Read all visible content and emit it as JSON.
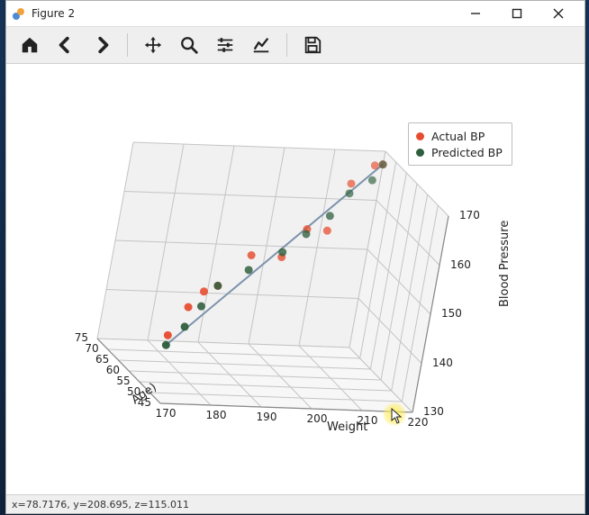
{
  "window": {
    "title": "Figure 2"
  },
  "toolbar": {
    "home": "Home",
    "back": "Back",
    "forward": "Forward",
    "pan": "Pan",
    "zoom": "Zoom",
    "configure": "Configure subplots",
    "edit": "Edit axis",
    "save": "Save"
  },
  "status": {
    "x_label": "x=",
    "x_val": "78.7176",
    "y_label": ", y=",
    "y_val": "208.695",
    "z_label": ", z=",
    "z_val": "115.011"
  },
  "legend": {
    "actual": "Actual BP",
    "predicted": "Predicted BP"
  },
  "axes": {
    "x_label": "Age)",
    "y_label": "Weight",
    "z_label": "Blood Pressure",
    "x_ticks": [
      "45",
      "50",
      "55",
      "60",
      "65",
      "70",
      "75"
    ],
    "y_ticks": [
      "170",
      "180",
      "190",
      "200",
      "210",
      "220"
    ],
    "z_ticks": [
      "130",
      "140",
      "150",
      "160",
      "170"
    ]
  },
  "chart_data": {
    "type": "scatter",
    "title": "",
    "xlabel": "Age)",
    "ylabel": "Weight",
    "zlabel": "Blood Pressure",
    "x_range": [
      45,
      75
    ],
    "y_range": [
      170,
      220
    ],
    "z_range": [
      130,
      170
    ],
    "series": [
      {
        "name": "Actual BP",
        "color": "#e64d30",
        "points": [
          {
            "age": 47,
            "weight": 170,
            "bp": 143
          },
          {
            "age": 49,
            "weight": 174,
            "bp": 148
          },
          {
            "age": 52,
            "weight": 178,
            "bp": 150
          },
          {
            "age": 55,
            "weight": 182,
            "bp": 150
          },
          {
            "age": 56,
            "weight": 188,
            "bp": 156
          },
          {
            "age": 58,
            "weight": 195,
            "bp": 155
          },
          {
            "age": 60,
            "weight": 200,
            "bp": 160
          },
          {
            "age": 62,
            "weight": 205,
            "bp": 159
          },
          {
            "age": 66,
            "weight": 210,
            "bp": 167
          },
          {
            "age": 68,
            "weight": 215,
            "bp": 170
          },
          {
            "age": 71,
            "weight": 218,
            "bp": 169
          }
        ]
      },
      {
        "name": "Predicted BP",
        "color": "#2e5e3d",
        "points": [
          {
            "age": 47,
            "weight": 170,
            "bp": 141
          },
          {
            "age": 49,
            "weight": 174,
            "bp": 144
          },
          {
            "age": 52,
            "weight": 178,
            "bp": 147
          },
          {
            "age": 55,
            "weight": 182,
            "bp": 150
          },
          {
            "age": 56,
            "weight": 188,
            "bp": 153
          },
          {
            "age": 58,
            "weight": 195,
            "bp": 156
          },
          {
            "age": 60,
            "weight": 200,
            "bp": 159
          },
          {
            "age": 62,
            "weight": 205,
            "bp": 162
          },
          {
            "age": 66,
            "weight": 210,
            "bp": 165
          },
          {
            "age": 68,
            "weight": 215,
            "bp": 167
          },
          {
            "age": 71,
            "weight": 218,
            "bp": 169
          }
        ]
      }
    ],
    "fit_line": [
      {
        "age": 47,
        "weight": 170,
        "bp": 141
      },
      {
        "age": 71,
        "weight": 218,
        "bp": 169
      }
    ],
    "legend_position": "upper right",
    "grid": true
  },
  "colors": {
    "actual": "#e64d30",
    "predicted": "#2e5e3d",
    "grid": "#bcbcbc",
    "axis": "#7a7a7a"
  }
}
